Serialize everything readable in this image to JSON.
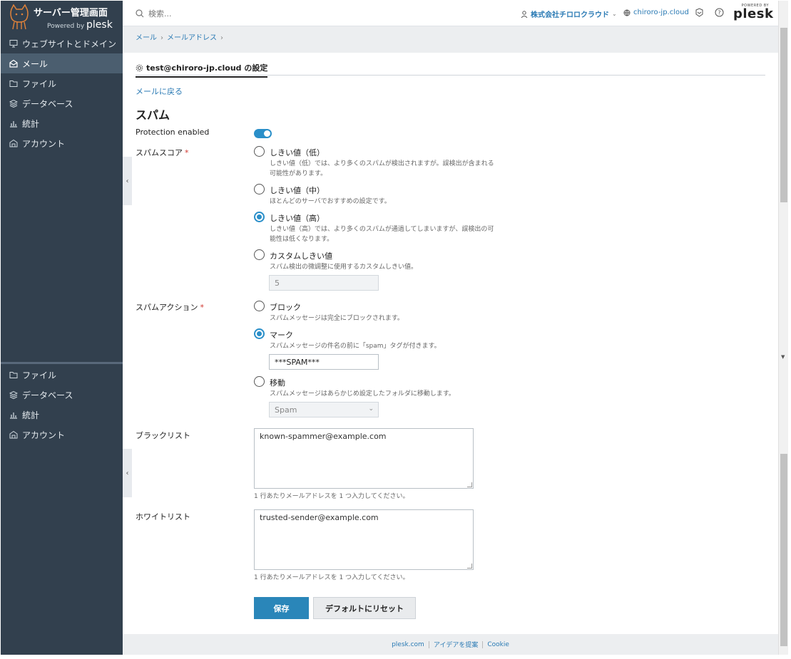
{
  "sidebar": {
    "title": "サーバー管理画面",
    "powered_by": "Powered by ",
    "powered_brand": "plesk",
    "items": [
      {
        "label": "ウェブサイトとドメイン",
        "icon": "monitor-icon"
      },
      {
        "label": "メール",
        "icon": "mail-icon",
        "active": true
      },
      {
        "label": "ファイル",
        "icon": "folder-icon"
      },
      {
        "label": "データベース",
        "icon": "database-icon"
      },
      {
        "label": "統計",
        "icon": "chart-icon"
      },
      {
        "label": "アカウント",
        "icon": "account-icon"
      }
    ],
    "lower_items": [
      {
        "label": "ファイル",
        "icon": "folder-icon"
      },
      {
        "label": "データベース",
        "icon": "database-icon"
      },
      {
        "label": "統計",
        "icon": "chart-icon"
      },
      {
        "label": "アカウント",
        "icon": "account-icon"
      }
    ]
  },
  "header": {
    "search_placeholder": "検索...",
    "account": "株式会社チロロクラウド",
    "domain": "chiroro-jp.cloud",
    "brand_small": "POWERED BY",
    "brand": "plesk"
  },
  "breadcrumb": [
    "メール",
    "メールアドレス"
  ],
  "tab_label": "test@chiroro-jp.cloud の設定",
  "back_link": "メールに戻る",
  "heading": "スパム",
  "protection": {
    "label": "Protection enabled",
    "enabled": true
  },
  "spam_score": {
    "label": "スパムスコア",
    "options": [
      {
        "label": "しきい値（低）",
        "hint": "しきい値（低）では、より多くのスパムが検出されますが。誤検出が含まれる可能性があります。",
        "selected": false
      },
      {
        "label": "しきい値（中）",
        "hint": "ほとんどのサーバでおすすめの設定です。",
        "selected": false
      },
      {
        "label": "しきい値（高）",
        "hint": "しきい値（高）では、より多くのスパムが通過してしまいますが、誤検出の可能性は低くなります。",
        "selected": true
      },
      {
        "label": "カスタムしきい値",
        "hint": "スパム検出の微調整に使用するカスタムしきい値。",
        "selected": false
      }
    ],
    "custom_value": "5"
  },
  "spam_action": {
    "label": "スパムアクション",
    "options": [
      {
        "label": "ブロック",
        "hint": "スパムメッセージは完全にブロックされます。",
        "selected": false
      },
      {
        "label": "マーク",
        "hint": "スパムメッセージの件名の前に「spam」タグが付きます。",
        "selected": true
      },
      {
        "label": "移動",
        "hint": "スパムメッセージはあらかじめ設定したフォルダに移動します。",
        "selected": false
      }
    ],
    "mark_tag": "***SPAM***",
    "move_folder": "Spam"
  },
  "blacklist": {
    "label": "ブラックリスト",
    "value": "known-spammer@example.com",
    "hint": "1 行あたりメールアドレスを 1 つ入力してください。"
  },
  "whitelist": {
    "label": "ホワイトリスト",
    "value": "trusted-sender@example.com",
    "hint": "1 行あたりメールアドレスを 1 つ入力してください。"
  },
  "buttons": {
    "save": "保存",
    "reset": "デフォルトにリセット"
  },
  "footer": [
    "plesk.com",
    "アイデアを提案",
    "Cookie"
  ]
}
